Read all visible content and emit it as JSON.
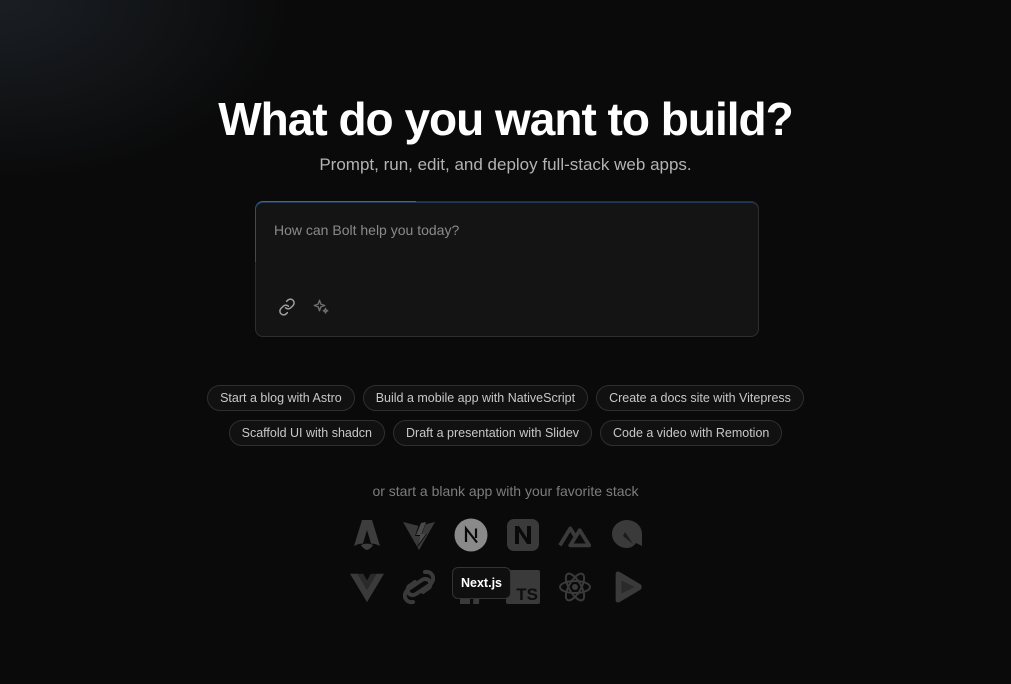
{
  "hero": {
    "title": "What do you want to build?",
    "subtitle": "Prompt, run, edit, and deploy full-stack web apps."
  },
  "prompt": {
    "placeholder": "How can Bolt help you today?",
    "tools": [
      {
        "icon": "link-icon"
      },
      {
        "icon": "sparkles-icon"
      }
    ]
  },
  "suggestions": {
    "row1": [
      "Start a blog with Astro",
      "Build a mobile app with NativeScript",
      "Create a docs site with Vitepress"
    ],
    "row2": [
      "Scaffold UI with shadcn",
      "Draft a presentation with Slidev",
      "Code a video with Remotion"
    ]
  },
  "stacks": {
    "label": "or start a blank app with your favorite stack",
    "row1": [
      "astro-icon",
      "vite-icon",
      "nextjs-icon",
      "nuxt-n-icon",
      "nuxt-icon",
      "qwik-icon"
    ],
    "row2": [
      "vue-icon",
      "svelte-icon",
      "remix-icon",
      "typescript-icon",
      "react-icon",
      "remotion-icon"
    ],
    "typescript_badge": "TS",
    "tooltip": "Next.js"
  },
  "colors": {
    "background": "#0a0a0a",
    "icon_dim": "#3a3a3a",
    "icon_hover": "#8a8a8a",
    "accent_border": "#3b82c4"
  }
}
